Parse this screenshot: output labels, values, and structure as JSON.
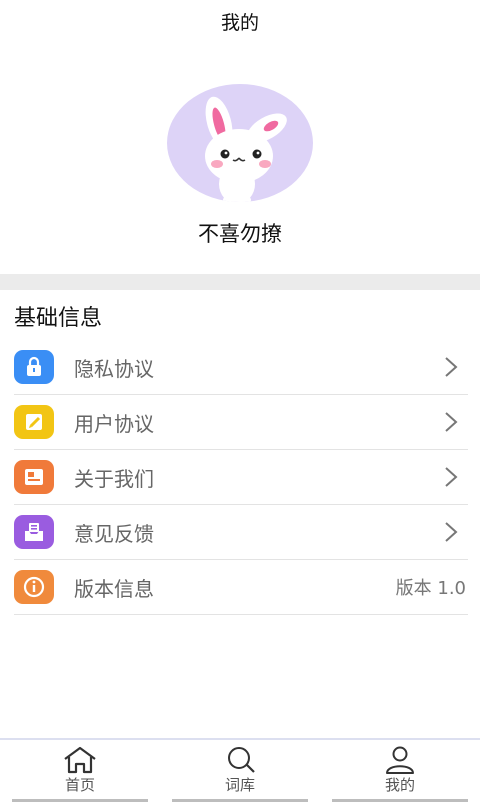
{
  "header": {
    "title": "我的"
  },
  "profile": {
    "nickname": "不喜勿撩"
  },
  "section": {
    "title": "基础信息"
  },
  "items": [
    {
      "label": "隐私协议",
      "icon": "lock-icon",
      "color": "#3a8ef5",
      "trailing": "chevron"
    },
    {
      "label": "用户协议",
      "icon": "edit-icon",
      "color": "#f2c514",
      "trailing": "chevron"
    },
    {
      "label": "关于我们",
      "icon": "card-icon",
      "color": "#f07a3a",
      "trailing": "chevron"
    },
    {
      "label": "意见反馈",
      "icon": "inbox-icon",
      "color": "#9a5ce0",
      "trailing": "chevron"
    },
    {
      "label": "版本信息",
      "icon": "info-icon",
      "color": "#f08a3c",
      "trailing": "text",
      "value": "版本 1.0"
    }
  ],
  "tabs": [
    {
      "label": "首页",
      "icon": "home-icon"
    },
    {
      "label": "词库",
      "icon": "search-icon"
    },
    {
      "label": "我的",
      "icon": "user-icon"
    }
  ]
}
